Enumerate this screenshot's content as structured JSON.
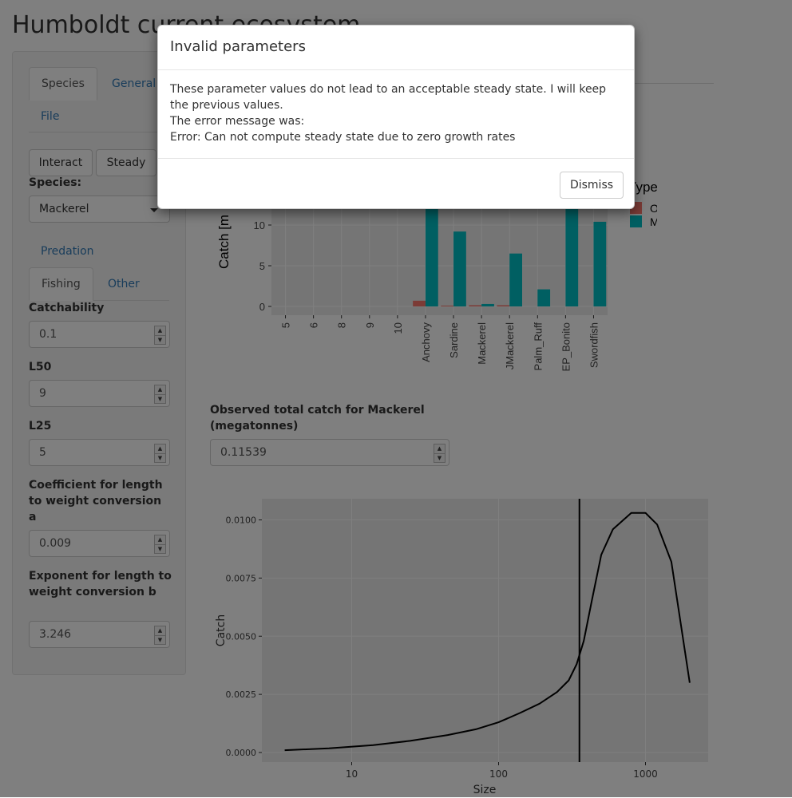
{
  "app_title": "Humboldt current ecosystem",
  "sidebar": {
    "top_tabs": [
      "Species",
      "General",
      "File"
    ],
    "buttons": [
      "Interact",
      "Steady"
    ],
    "species_label": "Species:",
    "species_value": "Mackerel",
    "sub_tabs": [
      "Predation",
      "Fishing",
      "Other"
    ],
    "fields": [
      {
        "label": "Catchability",
        "value": "0.1"
      },
      {
        "label": "L50",
        "value": "9"
      },
      {
        "label": "L25",
        "value": "5"
      },
      {
        "label": "Coefficient for length to weight conversion a",
        "value": "0.009"
      },
      {
        "label": "Exponent for length to weight conversion b",
        "value": "3.246"
      }
    ]
  },
  "catch_chart": {
    "ylabel": "Catch [m",
    "legend_title": "Type",
    "legend": [
      {
        "name": "Observed",
        "color": "#F8766D"
      },
      {
        "name": "Model",
        "color": "#00BFC4"
      }
    ],
    "yticks": [
      "0",
      "5",
      "10"
    ]
  },
  "observed_catch": {
    "label": "Observed total catch for Mackerel (megatonnes)",
    "value": "0.11539"
  },
  "chart_data": [
    {
      "type": "bar",
      "categories": [
        "5",
        "6",
        "8",
        "9",
        "10",
        "Anchovy",
        "Sardine",
        "Mackerel",
        "JMackerel",
        "Palm_Ruff",
        "EP_Bonito",
        "Swordfish"
      ],
      "series": [
        {
          "name": "Observed",
          "values": [
            0,
            0,
            0,
            0,
            0,
            0.7,
            0.1,
            0.15,
            0.15,
            0,
            0,
            0
          ]
        },
        {
          "name": "Model",
          "values": [
            0,
            0,
            0,
            0,
            0,
            13.5,
            9.2,
            0.3,
            6.5,
            2.1,
            13.5,
            10.4
          ]
        }
      ],
      "ylabel": "Catch [m",
      "yticks": [
        0,
        5,
        10
      ]
    },
    {
      "type": "line",
      "xlabel": "Size",
      "ylabel": "Catch",
      "xscale": "log",
      "x_ticks": [
        10,
        100,
        1000
      ],
      "y_ticks": [
        "0.0000",
        "0.0025",
        "0.0050",
        "0.0075",
        "0.0100"
      ],
      "ylim": [
        0,
        0.0107
      ],
      "vline_x": 355,
      "series": [
        {
          "x": [
            3.5,
            7,
            14,
            25,
            45,
            70,
            100,
            140,
            190,
            250,
            300,
            340,
            380,
            430,
            500,
            600,
            800,
            1000,
            1200,
            1500,
            2000
          ],
          "y": [
            0.0001,
            0.00018,
            0.00032,
            0.0005,
            0.00075,
            0.001,
            0.0013,
            0.0017,
            0.0021,
            0.0026,
            0.0031,
            0.0038,
            0.0048,
            0.0065,
            0.0085,
            0.0096,
            0.0103,
            0.0103,
            0.0098,
            0.0082,
            0.003
          ]
        }
      ]
    }
  ],
  "modal": {
    "title": "Invalid parameters",
    "body_line1": "These parameter values do not lead to an acceptable steady state. I will keep the previous values.",
    "body_line2": "The error message was:",
    "body_line3": "Error: Can not compute steady state due to zero growth rates",
    "dismiss_label": "Dismiss"
  }
}
